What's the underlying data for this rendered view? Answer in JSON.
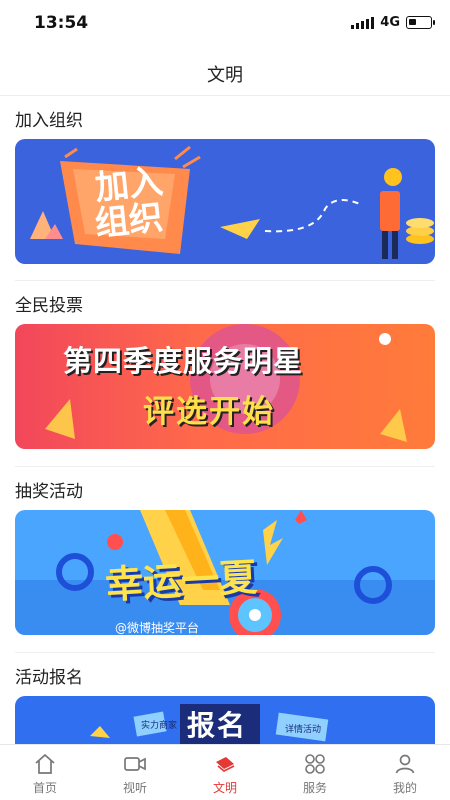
{
  "status_bar": {
    "time": "13:54",
    "network": "4G"
  },
  "nav": {
    "title": "文明"
  },
  "sections": [
    {
      "title": "加入组织",
      "banner_text": [
        "加入",
        "组织"
      ]
    },
    {
      "title": "全民投票",
      "banner_text": [
        "第四季度服务明星",
        "评选开始"
      ]
    },
    {
      "title": "抽奖活动",
      "banner_text": [
        "幸运一夏",
        "@微博抽奖平台"
      ]
    },
    {
      "title": "活动报名",
      "banner_text": [
        "报名",
        "实力商家",
        "详情活动"
      ]
    }
  ],
  "tabs": [
    {
      "label": "首页",
      "icon": "home-icon",
      "active": false
    },
    {
      "label": "视听",
      "icon": "video-icon",
      "active": false
    },
    {
      "label": "文明",
      "icon": "civilization-icon",
      "active": true
    },
    {
      "label": "服务",
      "icon": "services-grid-icon",
      "active": false
    },
    {
      "label": "我的",
      "icon": "profile-icon",
      "active": false
    }
  ],
  "colors": {
    "accent": "#e53935",
    "text": "#222222",
    "muted": "#777777"
  }
}
